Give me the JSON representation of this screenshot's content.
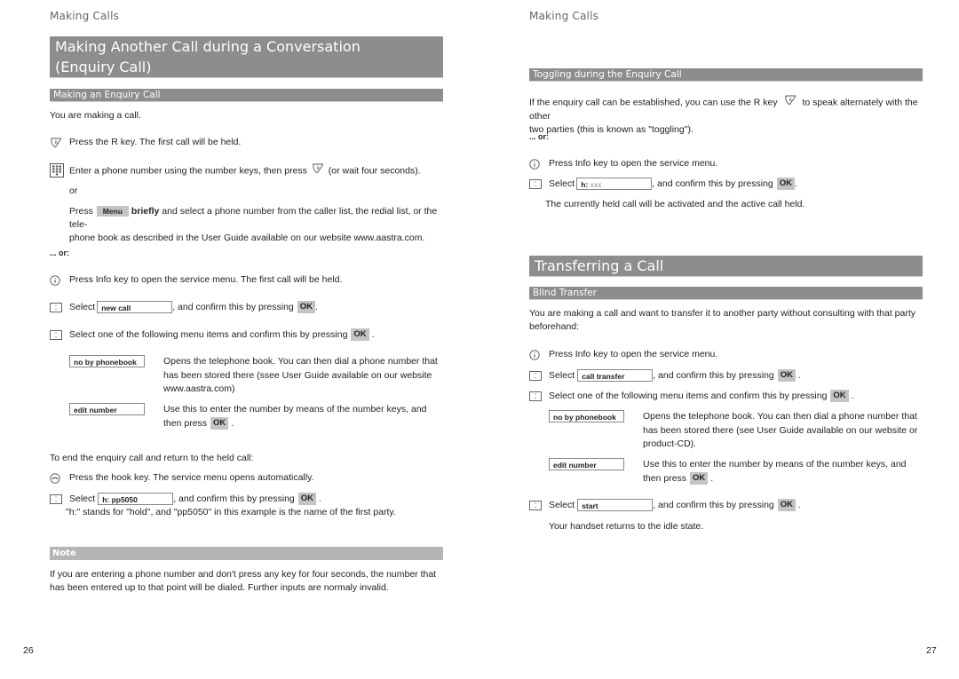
{
  "left_page": {
    "running_head": "Making Calls",
    "title_line1": "Making Another Call during a Conversation",
    "title_line2": "(Enquiry Call)",
    "subheading": "Making an Enquiry Call",
    "intro": "You are making a call.",
    "step_r_key": "Press the R key. The first call will be held.",
    "step_enter_number_pre": "Enter a phone number using the number keys, then press",
    "step_enter_number_post": "(or wait four seconds).",
    "or_label": "or",
    "press_label": "Press",
    "menu_key": "Menu",
    "briefly_label": "briefly",
    "menu_desc_line1": " and select a phone number from the caller list, the redial list, or the tele-",
    "menu_desc_line2": "phone book as described in the User Guide available on our website www.aastra.com.",
    "alt_or_label": "... or:",
    "step_info": "Press Info key to open the service menu. The first call will be held.",
    "select_label": "Select",
    "new_call_item": "new call",
    "confirm_text": ", and confirm this by pressing",
    "ok_key": "OK",
    "select_one_text": "Select one of the following menu items and confirm this by pressing",
    "options": [
      {
        "item": "no by phonebook",
        "desc": "Opens the telephone book. You can then dial a phone number that has been stored there (ssee User Guide available on our website www.aastra.com)"
      },
      {
        "item": "edit number",
        "desc_pre": "Use this to enter the number by means of the number keys, and then press"
      }
    ],
    "end_intro": "To end the enquiry call and return to the held call:",
    "step_hook": "Press the hook key. The service menu opens automatically.",
    "hold_item": "h: pp5050",
    "hold_explain": "\"h:\" stands for \"hold\", and \"pp5050\" in this example is the name of the first party.",
    "note_title": "Note",
    "note_text": "If you are entering a phone number and don't press any key for four seconds, the number that has been entered up to that point will be dialed. Further inputs are normaly invalid.",
    "page_number": "26"
  },
  "right_page": {
    "running_head": "Making Calls",
    "toggle_heading": "Toggling during the Enquiry Call",
    "toggle_text_pre": "If the enquiry call can be established, you can use the R key",
    "toggle_text_post": "to speak alternately with the other",
    "toggle_text_line2": "two parties (this is known as \"toggling\").",
    "alt_or_label": "... or:",
    "step_info": "Press Info key to open the service menu.",
    "select_label": "Select",
    "hold_item_prefix": "h:",
    "hold_item_placeholder": "xxx",
    "confirm_text": ", and confirm this by pressing",
    "ok_key": "OK",
    "held_activated": "The currently held call will be activated and the active call held.",
    "transfer_title": "Transferring a Call",
    "blind_heading": "Blind Transfer",
    "blind_intro": "You are making a call and want to transfer it to another party without consulting with that party beforehand:",
    "step_info2": "Press Info key to open the service menu.",
    "call_transfer_item": "call transfer",
    "select_one_text": "Select one of the following menu items and confirm this by pressing",
    "options": [
      {
        "item": "no by phonebook",
        "desc": "Opens the telephone book. You can then dial a phone number that has been stored there (see User Guide available on our website or product-CD)."
      },
      {
        "item": "edit number",
        "desc_pre": "Use this to enter the number by means of the number keys, and then press"
      }
    ],
    "start_item": "start",
    "idle_text": "Your handset returns to the idle state.",
    "page_number": "27"
  },
  "icons": {
    "r_key": "r-key-icon",
    "keypad": "keypad-icon",
    "info": "info-icon",
    "navigation": "navigation-key-icon",
    "hook": "hook-key-icon"
  }
}
